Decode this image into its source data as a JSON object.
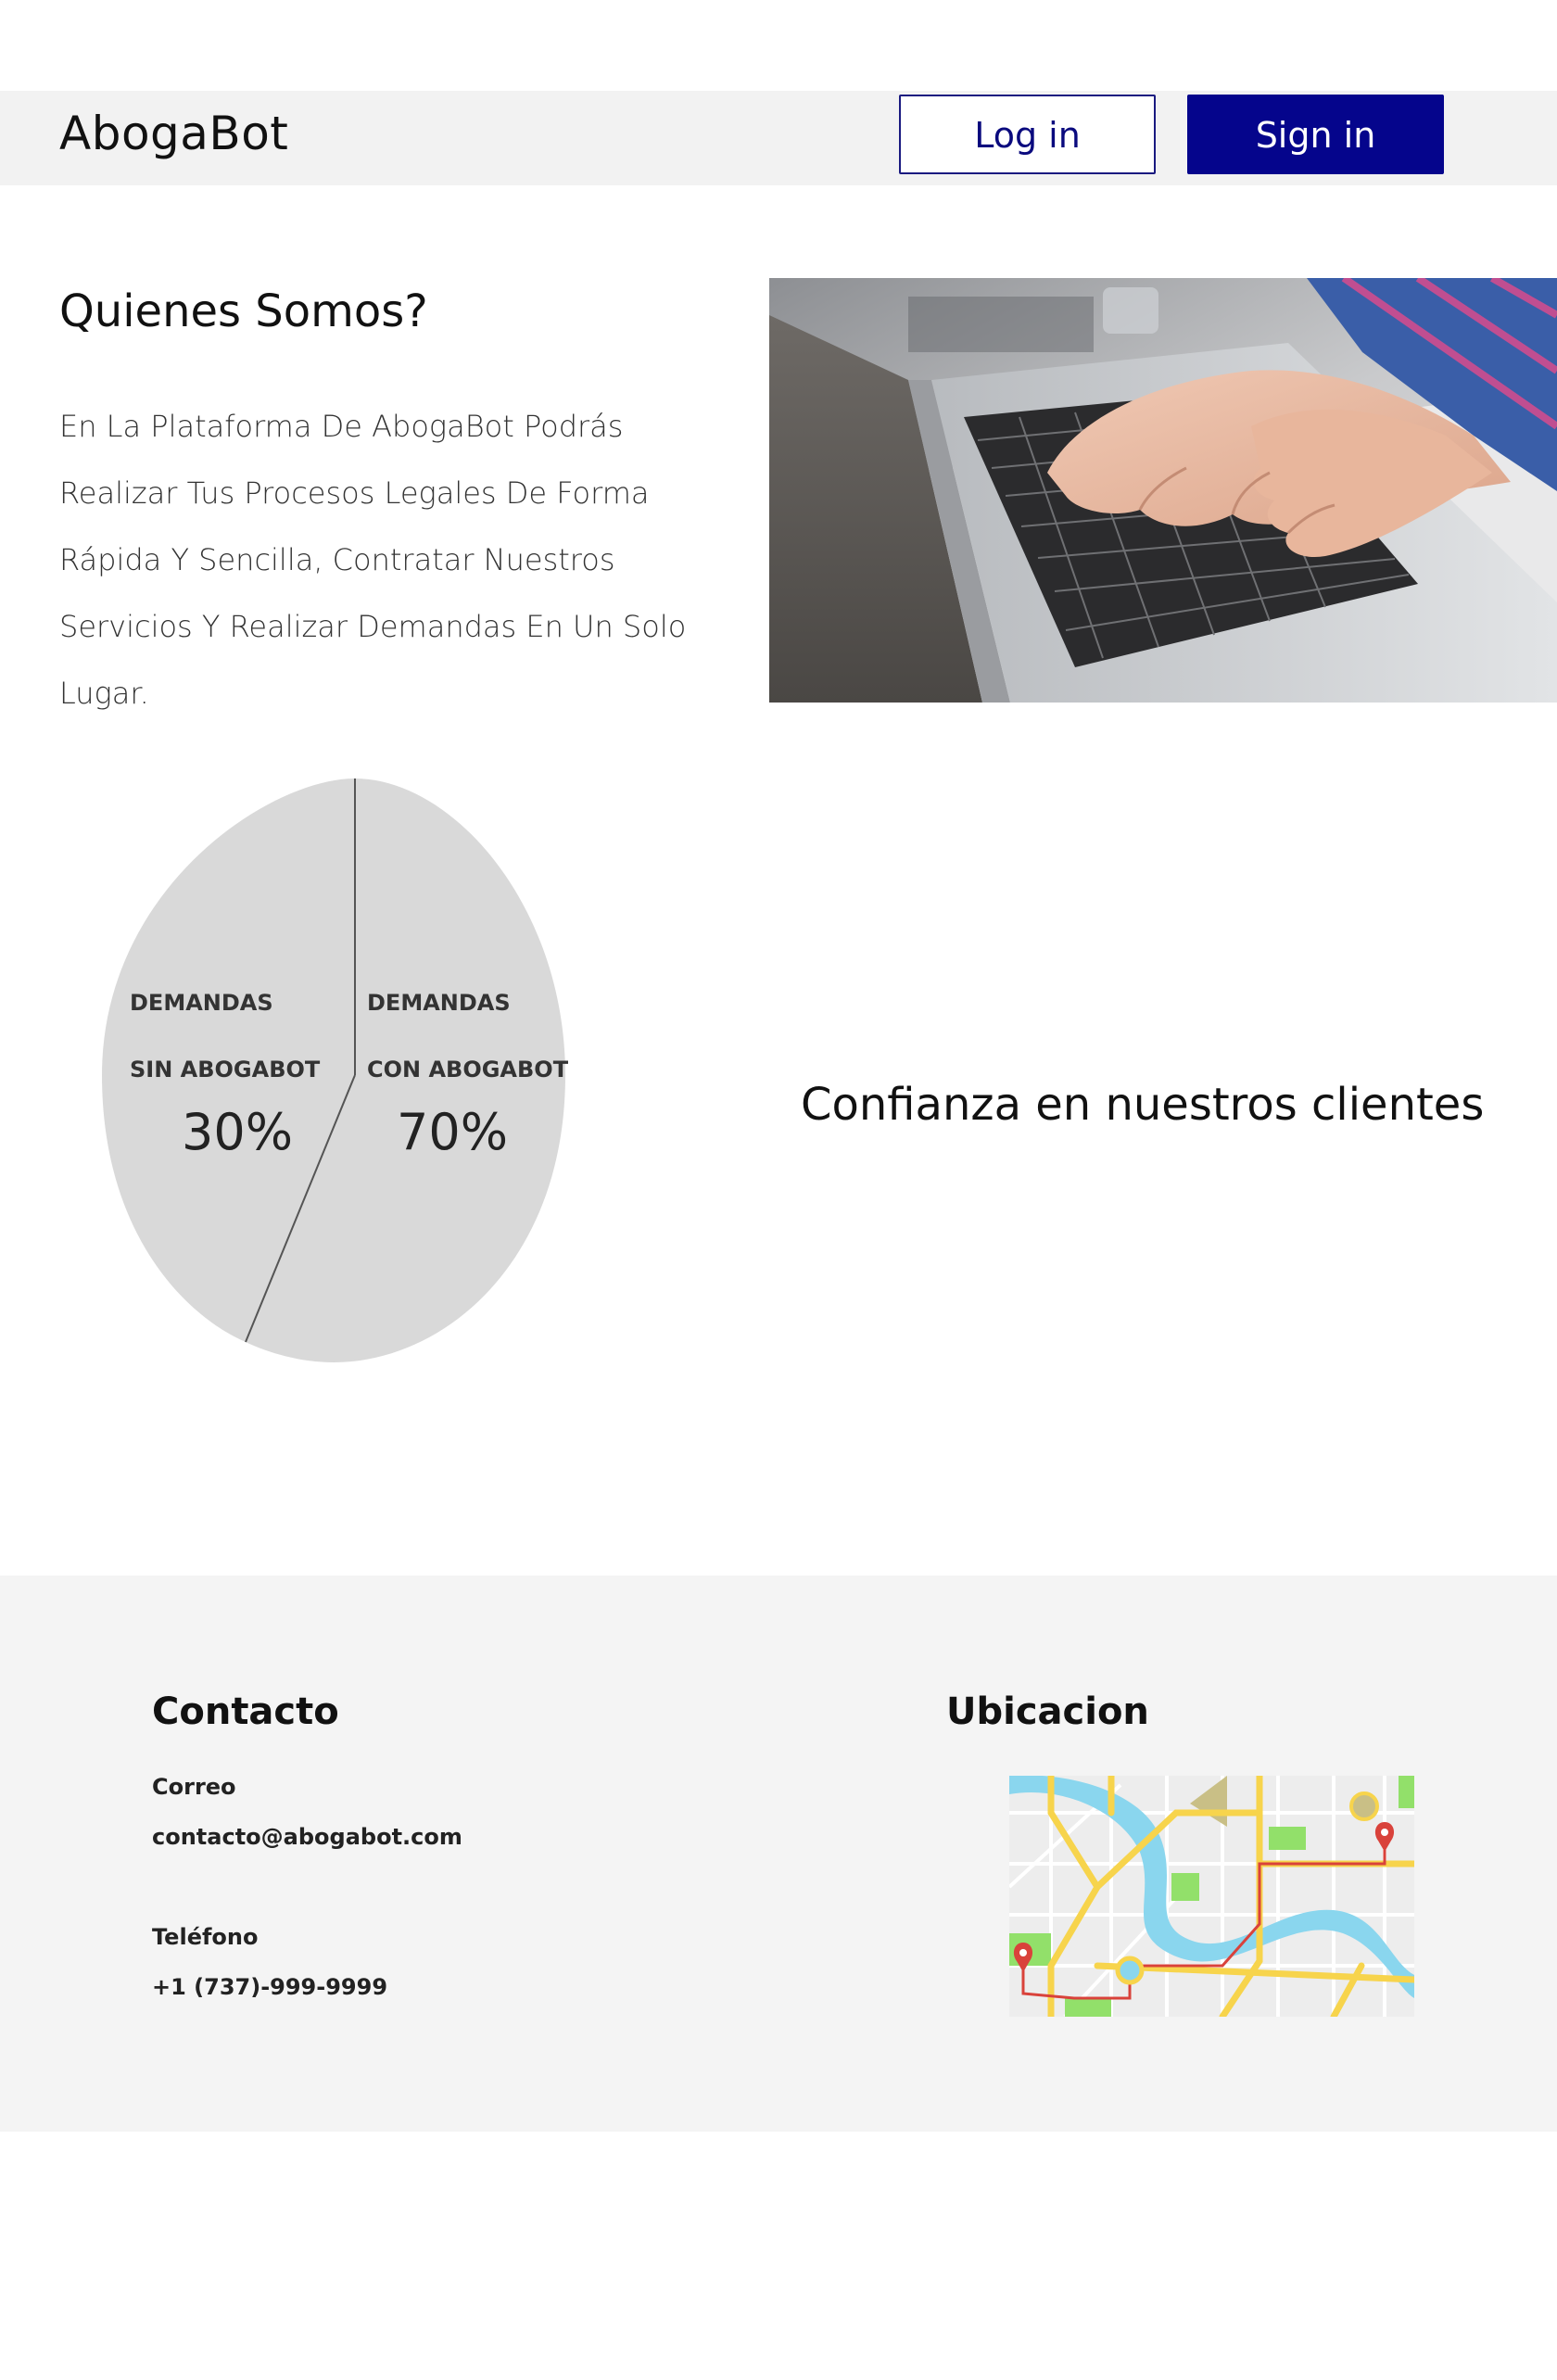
{
  "header": {
    "brand": "AbogaBot",
    "login_label": "Log in",
    "signin_label": "Sign in"
  },
  "about": {
    "title": "Quienes Somos?",
    "text": "En La Plataforma De AbogaBot Podrás Realizar Tus Procesos Legales De Forma Rápida Y Sencilla, Contratar Nuestros Servicios Y Realizar Demandas En Un Solo Lugar."
  },
  "stats": {
    "left_line1": "DEMANDAS",
    "left_line2": "SIN ABOGABOT",
    "left_pct": "30%",
    "right_line1": "DEMANDAS",
    "right_line2": "CON ABOGABOT",
    "right_pct": "70%",
    "trust_text": "Confianza en nuestros clientes",
    "pie_fill": "#d9d9d9"
  },
  "footer": {
    "contact_title": "Contacto",
    "email_label": "Correo",
    "email_value": "contacto@abogabot.com",
    "phone_label": "Teléfono",
    "phone_value": "+1 (737)-999-9999",
    "location_title": "Ubicacion"
  },
  "colors": {
    "primary": "#05058c",
    "header_bg": "#f2f2f2",
    "footer_bg": "#f4f4f4"
  }
}
